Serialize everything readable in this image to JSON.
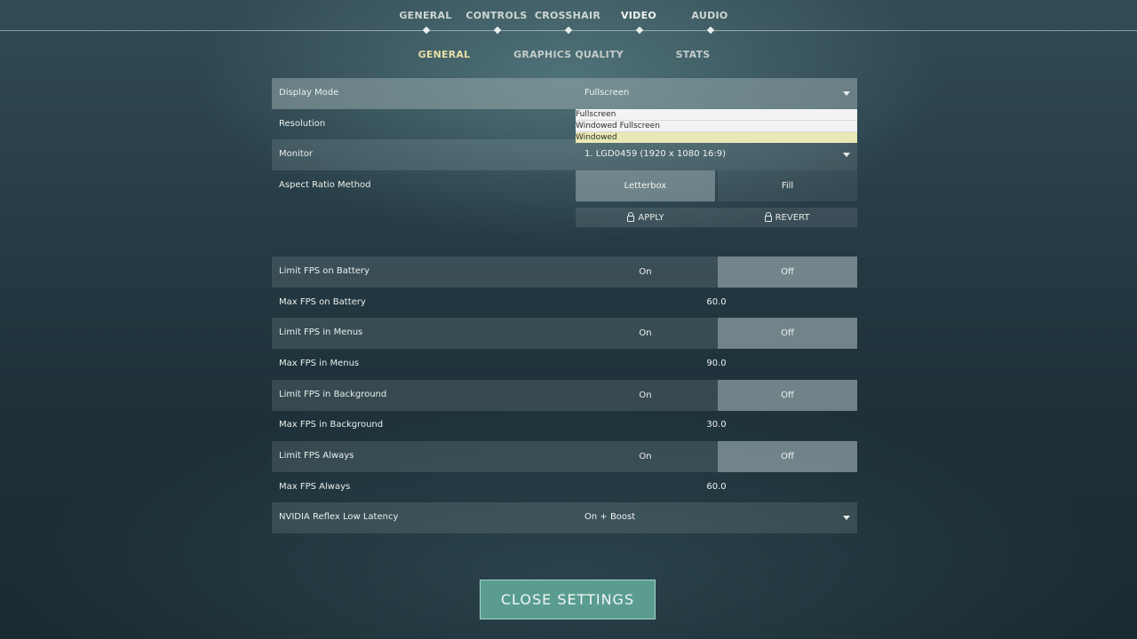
{
  "nav": {
    "tabs": [
      {
        "label": "GENERAL"
      },
      {
        "label": "CONTROLS"
      },
      {
        "label": "CROSSHAIR"
      },
      {
        "label": "VIDEO"
      },
      {
        "label": "AUDIO"
      }
    ],
    "active_tab": "VIDEO"
  },
  "subnav": {
    "tabs": [
      {
        "label": "GENERAL"
      },
      {
        "label": "GRAPHICS QUALITY"
      },
      {
        "label": "STATS"
      }
    ],
    "active_tab": "GENERAL"
  },
  "settings": {
    "display_mode": {
      "label": "Display Mode",
      "value": "Fullscreen"
    },
    "display_mode_options": [
      "Fullscreen",
      "Windowed Fullscreen",
      "Windowed"
    ],
    "resolution": {
      "label": "Resolution"
    },
    "monitor": {
      "label": "Monitor",
      "value": "1. LGD0459 (1920 x  1080 16:9)"
    },
    "aspect_ratio": {
      "label": "Aspect Ratio Method",
      "option_a": "Letterbox",
      "option_b": "Fill",
      "selected": "Letterbox"
    },
    "apply_label": "APPLY",
    "revert_label": "REVERT",
    "limit_fps_battery": {
      "label": "Limit FPS on Battery",
      "on": "On",
      "off": "Off",
      "selected": "Off"
    },
    "max_fps_battery": {
      "label": "Max FPS on Battery",
      "value": "60.0"
    },
    "limit_fps_menus": {
      "label": "Limit FPS in Menus",
      "on": "On",
      "off": "Off",
      "selected": "Off"
    },
    "max_fps_menus": {
      "label": "Max FPS in Menus",
      "value": "90.0"
    },
    "limit_fps_background": {
      "label": "Limit FPS in Background",
      "on": "On",
      "off": "Off",
      "selected": "Off"
    },
    "max_fps_background": {
      "label": "Max FPS in Background",
      "value": "30.0"
    },
    "limit_fps_always": {
      "label": "Limit FPS Always",
      "on": "On",
      "off": "Off",
      "selected": "Off"
    },
    "max_fps_always": {
      "label": "Max FPS Always",
      "value": "60.0"
    },
    "nvidia_reflex": {
      "label": "NVIDIA Reflex Low Latency",
      "value": "On + Boost"
    }
  },
  "close_button": "CLOSE SETTINGS",
  "colors": {
    "accent_yellow": "#e6dfa5",
    "close_button": "#5a9d90",
    "dropdown_hover": "#e9e9b6"
  }
}
